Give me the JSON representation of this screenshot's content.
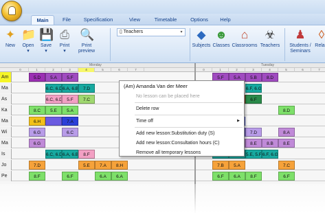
{
  "tabs": [
    {
      "label": "Main",
      "active": true
    },
    {
      "label": "File"
    },
    {
      "label": "Specification"
    },
    {
      "label": "View"
    },
    {
      "label": "Timetable"
    },
    {
      "label": "Options"
    },
    {
      "label": "Help"
    }
  ],
  "ribbon": {
    "buttons": [
      "New",
      "Open",
      "Save",
      "Print",
      "Print preview"
    ],
    "combo_value": "Teachers",
    "view_buttons": [
      "Subjects",
      "Classes",
      "Classrooms",
      "Teachers"
    ],
    "extra_button": "Students / Seminars",
    "clipped_text": "Rela"
  },
  "grid": {
    "days": [
      "Monday",
      "Tuesday"
    ],
    "periods": [
      "0",
      "1",
      "2",
      "3",
      "4",
      "5",
      "6",
      "7"
    ],
    "highlight_period": "4",
    "rows": [
      {
        "name": "Am",
        "selected": true,
        "cells": [
          {
            "c": 1,
            "t": "5.D",
            "bg": "#9b2fb3"
          },
          {
            "c": 2,
            "t": "5.A",
            "bg": "#a04bc0"
          },
          {
            "c": 3,
            "t": "5.F",
            "bg": "#a04bc0"
          },
          {
            "c": 8,
            "t": "5.F",
            "bg": "#a04bc0"
          },
          {
            "c": 9,
            "t": "5.A",
            "bg": "#a04bc0"
          },
          {
            "c": 10,
            "t": "5.B",
            "bg": "#a04bc0"
          },
          {
            "c": 11,
            "t": "8.D",
            "bg": "#a04bc0"
          }
        ]
      },
      {
        "name": "Ma",
        "cells": [
          {
            "c": 2,
            "t": "6.C, 6.D",
            "bg": "#18a9a0"
          },
          {
            "c": 3,
            "t": "6.A, 6.B",
            "bg": "#18a9a0"
          },
          {
            "c": 4,
            "t": "7.D",
            "bg": "#18a9a0"
          },
          {
            "c": 8,
            "t": "7.A, 7.B",
            "bg": "#18a9a0"
          },
          {
            "c": 10,
            "t": "6.F, 6.G",
            "bg": "#18a9a0"
          }
        ]
      },
      {
        "name": "As",
        "cells": [
          {
            "c": 2,
            "t": "6.C, 6.D",
            "bg": "#f3a0c4"
          },
          {
            "c": 3,
            "t": "5.F",
            "bg": "#f3a0c4"
          },
          {
            "c": 4,
            "t": "7.C",
            "bg": "#a0d870"
          },
          {
            "c": 9,
            "t": "5.E, 5.F",
            "bg": "#c04a1a"
          },
          {
            "c": 10,
            "t": "6.F",
            "bg": "#2a8a4a"
          }
        ]
      },
      {
        "name": "Ka",
        "cells": [
          {
            "c": 1,
            "t": "8.C",
            "bg": "#7ee06a"
          },
          {
            "c": 2,
            "t": "5.E",
            "bg": "#7ee06a"
          },
          {
            "c": 3,
            "t": "5.A",
            "bg": "#7ee06a"
          },
          {
            "c": 8,
            "t": "8.G",
            "bg": "#7ee06a"
          },
          {
            "c": 12,
            "t": "8.D",
            "bg": "#7ee06a"
          }
        ]
      },
      {
        "name": "Ma",
        "cells": [
          {
            "c": 1,
            "t": "6.H",
            "bg": "#f2c11a"
          },
          {
            "c": 2,
            "t": "",
            "bg": "#6a5be0"
          },
          {
            "c": 3,
            "t": "7.A",
            "bg": "#2b3fd8"
          },
          {
            "c": 9,
            "t": "7.A",
            "bg": "#2b3fd8"
          }
        ]
      },
      {
        "name": "Wi",
        "cells": [
          {
            "c": 1,
            "t": "6.G",
            "bg": "#b89ce8"
          },
          {
            "c": 3,
            "t": "6.C",
            "bg": "#b89ce8"
          },
          {
            "c": 9,
            "t": "",
            "bg": "#4a3fd0"
          },
          {
            "c": 10,
            "t": "7.D",
            "bg": "#b89ce8"
          },
          {
            "c": 12,
            "t": "8.A",
            "bg": "#c08ad8"
          }
        ]
      },
      {
        "name": "Ma",
        "cells": [
          {
            "c": 1,
            "t": "6.G",
            "bg": "#c08ad8"
          },
          {
            "c": 9,
            "t": "8.E",
            "bg": "#c08ad8"
          },
          {
            "c": 10,
            "t": "8.E",
            "bg": "#c08ad8"
          },
          {
            "c": 11,
            "t": "8.B",
            "bg": "#c08ad8"
          },
          {
            "c": 12,
            "t": "8.E",
            "bg": "#c08ad8"
          }
        ]
      },
      {
        "name": "Is",
        "cells": [
          {
            "c": 2,
            "t": "6.C, 6.D",
            "bg": "#18a9a0"
          },
          {
            "c": 3,
            "t": "6.A, 6.B",
            "bg": "#18a9a0"
          },
          {
            "c": 4,
            "t": "8.F",
            "bg": "#f3a0c4"
          },
          {
            "c": 8,
            "t": "8.A, 8.C",
            "bg": "#18a9a0"
          },
          {
            "c": 9,
            "t": "7.A, 7.B",
            "bg": "#18a9a0"
          },
          {
            "c": 10,
            "t": "5.E, 5.F",
            "bg": "#18a9a0"
          },
          {
            "c": 11,
            "t": "6.F, 6.G",
            "bg": "#18a9a0"
          }
        ]
      },
      {
        "name": "Jo",
        "cells": [
          {
            "c": 1,
            "t": "7.D",
            "bg": "#f6a23a"
          },
          {
            "c": 4,
            "t": "5.E",
            "bg": "#f6a23a"
          },
          {
            "c": 5,
            "t": "7.A",
            "bg": "#f6a23a"
          },
          {
            "c": 6,
            "t": "8.H",
            "bg": "#f6a23a"
          },
          {
            "c": 8,
            "t": "7.B",
            "bg": "#f6a23a"
          },
          {
            "c": 9,
            "t": "5.A",
            "bg": "#f6a23a"
          },
          {
            "c": 12,
            "t": "7.C",
            "bg": "#f6a23a"
          }
        ]
      },
      {
        "name": "Pe",
        "cells": [
          {
            "c": 1,
            "t": "8.F",
            "bg": "#7ee06a"
          },
          {
            "c": 3,
            "t": "6.F",
            "bg": "#7ee06a"
          },
          {
            "c": 5,
            "t": "6.A",
            "bg": "#7ee06a"
          },
          {
            "c": 6,
            "t": "6.A",
            "bg": "#7ee06a"
          },
          {
            "c": 8,
            "t": "6.F",
            "bg": "#7ee06a"
          },
          {
            "c": 9,
            "t": "6.A",
            "bg": "#7ee06a"
          },
          {
            "c": 10,
            "t": "8.F",
            "bg": "#7ee06a"
          },
          {
            "c": 12,
            "t": "6.F",
            "bg": "#7ee06a"
          }
        ]
      }
    ]
  },
  "context_menu": {
    "header": "(Am) Amanda Van der Meer",
    "items": [
      {
        "label": "No lesson can be placed here",
        "disabled": true
      },
      {
        "label": "Delete row"
      },
      {
        "label": "Time off",
        "submenu": true
      },
      {
        "label": "Add new lesson:Substitution duty (S)"
      },
      {
        "label": "Add new lesson:Consultation hours (C)"
      },
      {
        "label": "Remove all temporary lessons"
      }
    ]
  },
  "colors": {
    "accent": "#15428b",
    "selected_row": "#f5f527"
  }
}
